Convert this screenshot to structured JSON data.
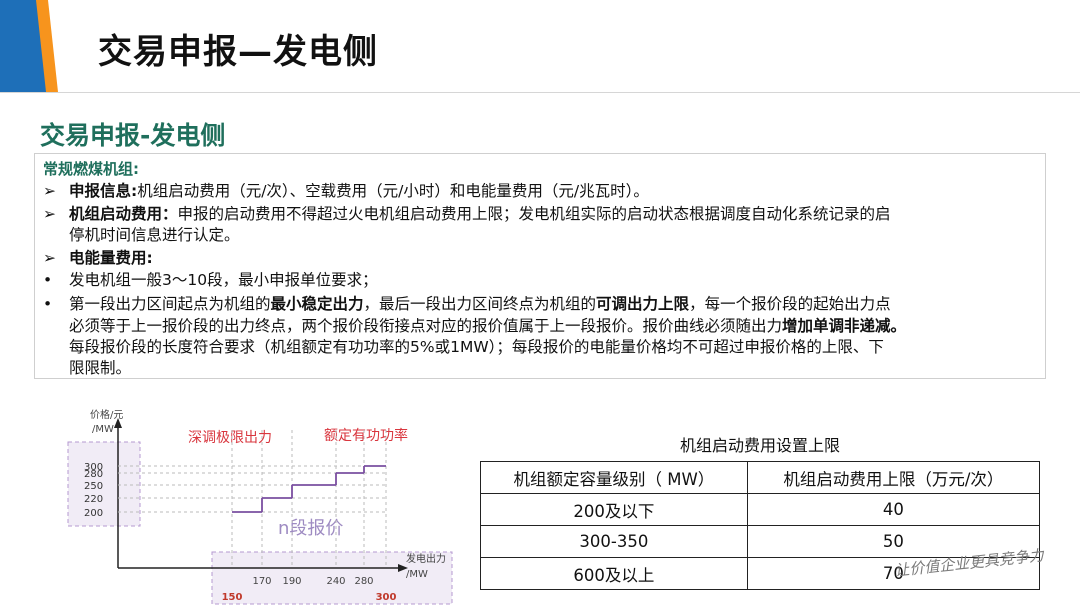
{
  "slide": {
    "title": "交易申报—发电侧",
    "section_title": "交易申报-发电侧",
    "accent_colors": {
      "orange": "#f7941d",
      "blue": "#1e6fb8",
      "teal": "#1f6f5c"
    }
  },
  "content": {
    "category": "常规燃煤机组:",
    "bullet_arrow": "➢",
    "bullet_dot": "•",
    "item1": {
      "label": "申报信息:",
      "text": "机组启动费用（元/次）、空载费用（元/小时）和电能量费用（元/兆瓦时）。"
    },
    "item2": {
      "label": "机组启动费用：",
      "text1": "申报的启动费用不得超过火电机组启动费用上限；发电机组实际的启动状态根据调度自动化系统记录的启",
      "text2": "停机时间信息进行认定。"
    },
    "item3": {
      "label": "电能量费用:"
    },
    "dot1": "发电机组一般3～10段，最小申报单位要求；",
    "dot2": {
      "p1": "第一段出力区间起点为机组的",
      "b1": "最小稳定出力",
      "p2": "，最后一段出力区间终点为机组的",
      "b2": "可调出力上限",
      "p3": "，每一个报价段的起始出力点",
      "line2a": "必须等于上一报价段的出力终点，两个报价段衔接点对应的报价值属于上一段报价。报价曲线必须随出力",
      "b3": "增加单调非递减。",
      "line3": "每段报价段的长度符合要求（机组额定有功功率的5%或1MW）；每段报价的电能量价格均不可超过申报价格的上限、下",
      "line4": "限限制。"
    }
  },
  "chart": {
    "y_label_1": "价格/元",
    "y_label_2": "/MW",
    "x_label_1": "发电出力",
    "x_label_2": "/MW",
    "annotation_left": "深调极限出力",
    "annotation_right": "额定有功功率",
    "center_label": "n段报价"
  },
  "chart_data": {
    "type": "line",
    "title": "",
    "xlabel": "发电出力 /MW",
    "ylabel": "价格/元 /MW",
    "x_ticks": [
      150,
      170,
      190,
      240,
      280,
      300
    ],
    "y_ticks": [
      200,
      220,
      250,
      280,
      300
    ],
    "series": [
      {
        "values": [
          {
            "x_start": 150,
            "x_end": 170,
            "y": 200
          },
          {
            "x_start": 170,
            "x_end": 190,
            "y": 220
          },
          {
            "x_start": 190,
            "x_end": 240,
            "y": 250
          },
          {
            "x_start": 240,
            "x_end": 280,
            "y": 280
          },
          {
            "x_start": 280,
            "x_end": 300,
            "y": 300
          }
        ]
      }
    ],
    "grid": false
  },
  "table": {
    "title": "机组启动费用设置上限",
    "headers": [
      "机组额定容量级别（ MW）",
      "机组启动费用上限（万元/次）"
    ],
    "rows": [
      [
        "200及以下",
        "40"
      ],
      [
        "300-350",
        "50"
      ],
      [
        "600及以上",
        "70"
      ]
    ]
  },
  "watermark": "让价值企业更具竞争力"
}
